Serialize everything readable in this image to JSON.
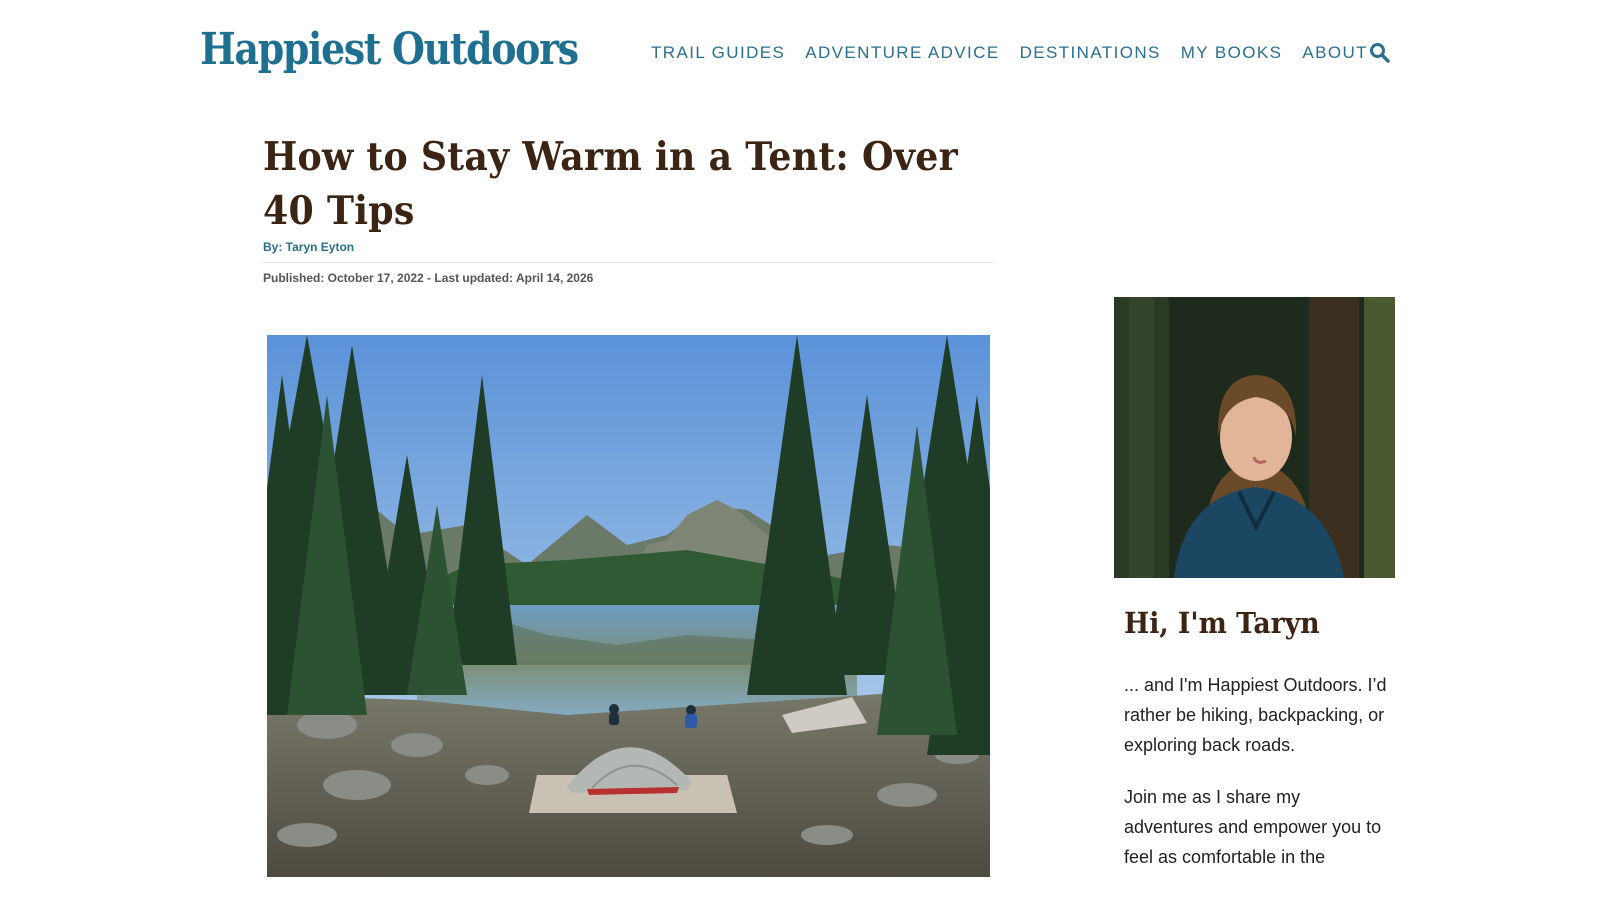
{
  "brand": {
    "logo": "Happiest Outdoors",
    "color": "#1f7090"
  },
  "nav": {
    "items": [
      "TRAIL GUIDES",
      "ADVENTURE ADVICE",
      "DESTINATIONS",
      "MY BOOKS",
      "ABOUT"
    ]
  },
  "article": {
    "title": "How to Stay Warm in a Tent: Over 40 Tips",
    "byline_prefix": "By: ",
    "author": "Taryn Eyton",
    "meta": "Published: October 17, 2022 - Last updated: April 14, 2026",
    "hero_image": "tent-on-wooden-platform-by-alpine-lake-photo"
  },
  "sidebar": {
    "portrait": "taryn-portrait-photo",
    "heading": "Hi, I'm Taryn",
    "paragraphs": [
      "... and I'm Happiest Outdoors. I’d rather be hiking, backpacking, or exploring back roads.",
      "Join me as I share my adventures and empower you to feel as comfortable in the"
    ]
  },
  "colors": {
    "nav": "#2b6f8c",
    "heading": "#3b2414",
    "text": "#222222"
  }
}
